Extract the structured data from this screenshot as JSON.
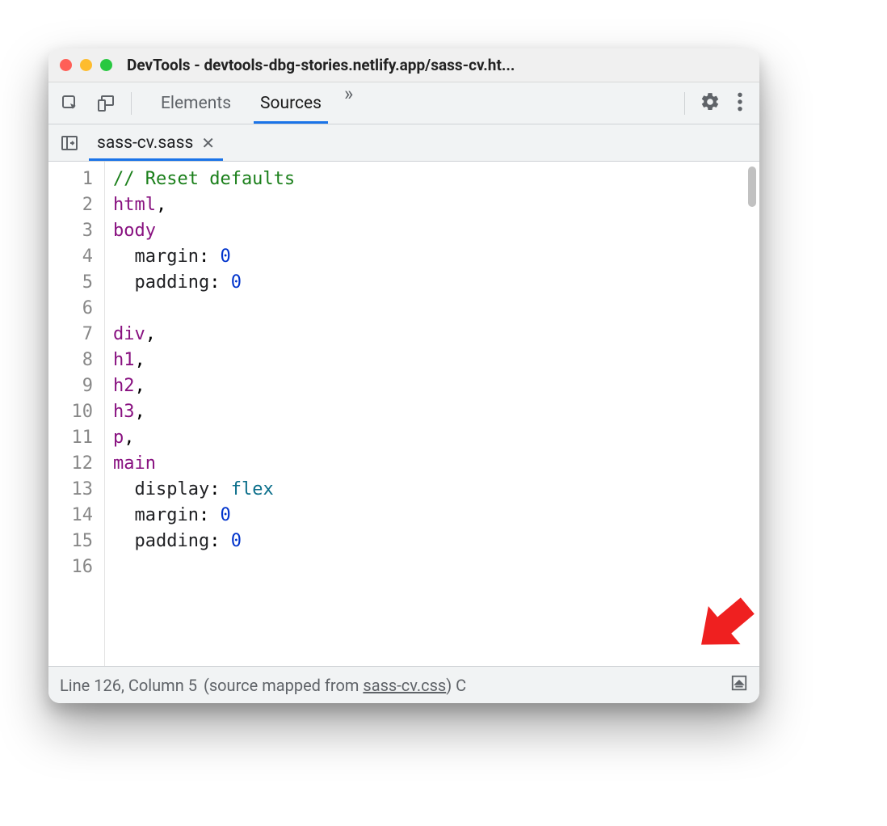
{
  "window": {
    "title": "DevTools - devtools-dbg-stories.netlify.app/sass-cv.ht..."
  },
  "toolbar": {
    "tabs": [
      {
        "label": "Elements",
        "active": false
      },
      {
        "label": "Sources",
        "active": true
      }
    ],
    "more_glyph": "»"
  },
  "fileTabs": [
    {
      "label": "sass-cv.sass",
      "active": true
    }
  ],
  "code": {
    "lines": [
      {
        "n": "1",
        "html": "<span class='tok-comment'>// Reset defaults</span>"
      },
      {
        "n": "2",
        "html": "<span class='tok-selector'>html</span>,"
      },
      {
        "n": "3",
        "html": "<span class='tok-selector'>body</span>"
      },
      {
        "n": "4",
        "html": "  <span class='tok-prop'>margin</span>: <span class='tok-value'>0</span>"
      },
      {
        "n": "5",
        "html": "  <span class='tok-prop'>padding</span>: <span class='tok-value'>0</span>"
      },
      {
        "n": "6",
        "html": ""
      },
      {
        "n": "7",
        "html": "<span class='tok-selector'>div</span>,"
      },
      {
        "n": "8",
        "html": "<span class='tok-selector'>h1</span>,"
      },
      {
        "n": "9",
        "html": "<span class='tok-selector'>h2</span>,"
      },
      {
        "n": "10",
        "html": "<span class='tok-selector'>h3</span>,"
      },
      {
        "n": "11",
        "html": "<span class='tok-selector'>p</span>,"
      },
      {
        "n": "12",
        "html": "<span class='tok-selector'>main</span>"
      },
      {
        "n": "13",
        "html": "  <span class='tok-prop'>display</span>: <span class='tok-ident'>flex</span>"
      },
      {
        "n": "14",
        "html": "  <span class='tok-prop'>margin</span>: <span class='tok-value'>0</span>"
      },
      {
        "n": "15",
        "html": "  <span class='tok-prop'>padding</span>: <span class='tok-value'>0</span>"
      },
      {
        "n": "16",
        "html": ""
      }
    ]
  },
  "status": {
    "position": "Line 126, Column 5",
    "mapped_prefix": "(source mapped from ",
    "mapped_link": "sass-cv.css",
    "mapped_suffix": ")",
    "trailing": " C"
  }
}
